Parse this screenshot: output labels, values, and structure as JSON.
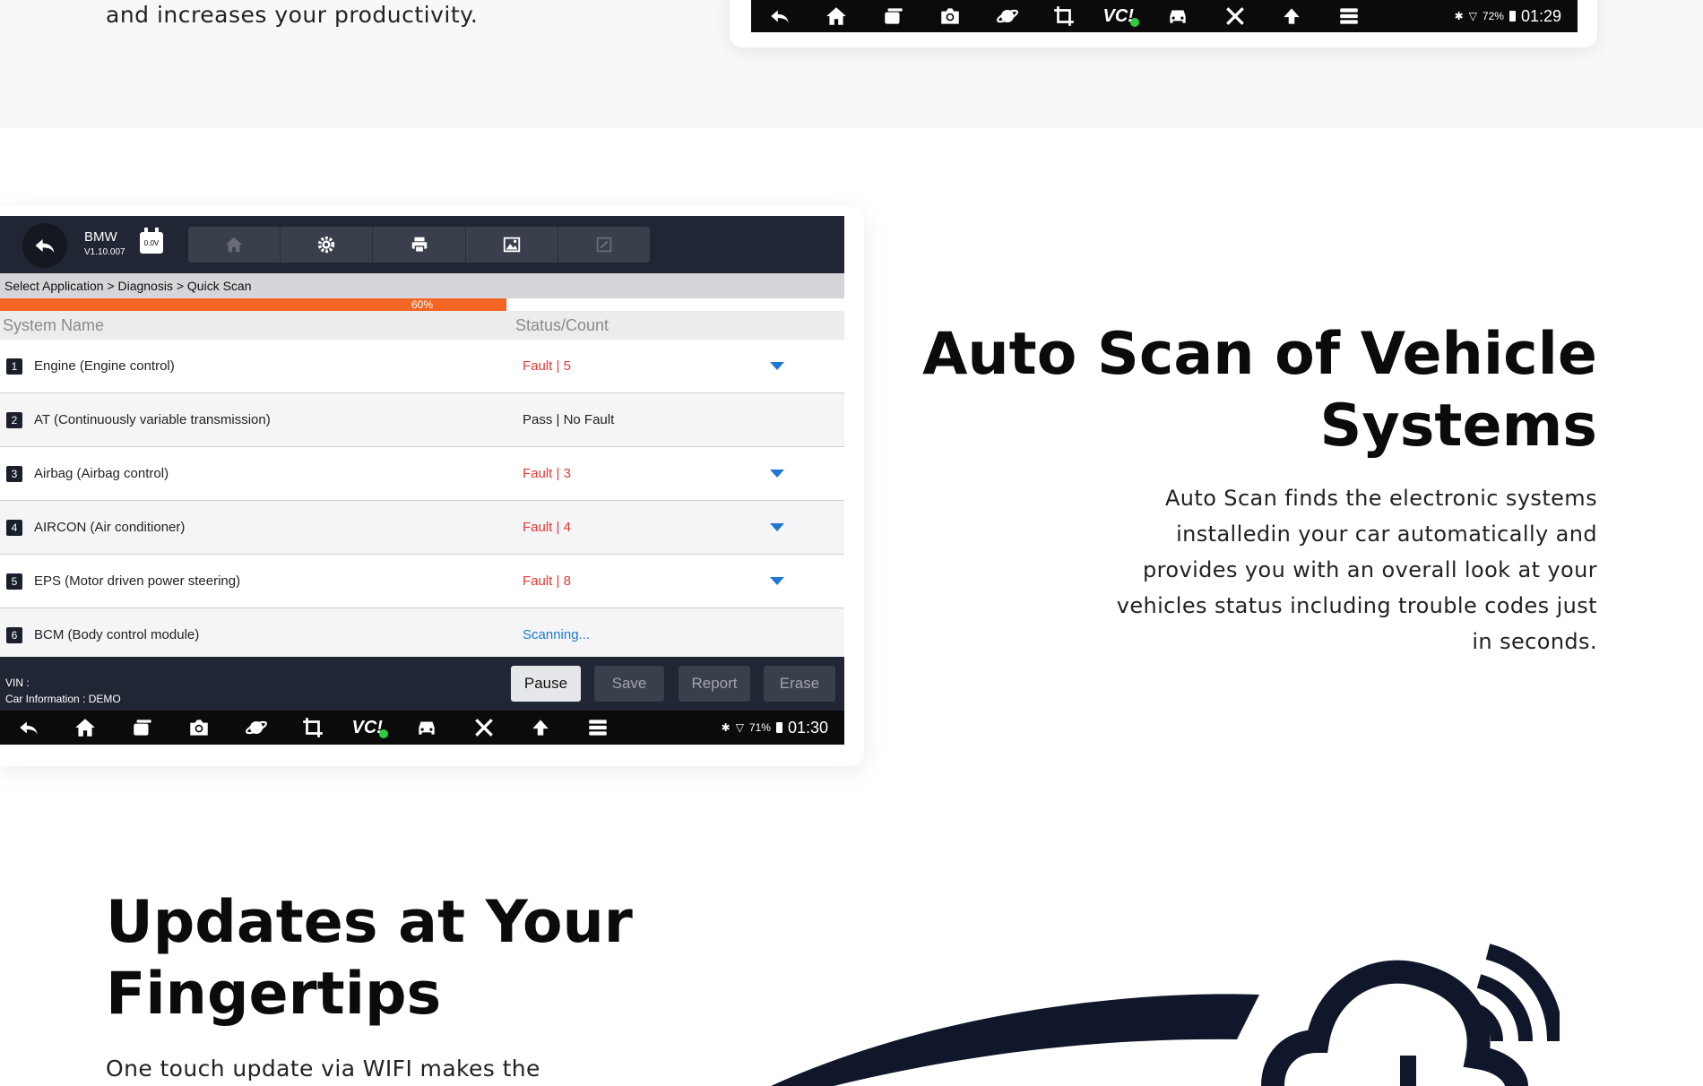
{
  "top_section": {
    "text": "and increases your productivity.",
    "statusbar": {
      "bluetooth": "✱",
      "wifi": "▽",
      "battery": "72%",
      "time": "01:29"
    }
  },
  "nav_icons": [
    "back-icon",
    "home-icon",
    "recent-apps-icon",
    "camera-icon",
    "planet-icon",
    "crop-icon",
    "vci-icon",
    "car-icon",
    "tools-icon",
    "upload-icon",
    "menu-icon"
  ],
  "vci_label": "VC!",
  "auto_scan_screen": {
    "brand": "BMW",
    "version": "V1.10.007",
    "voltage": "0.0V",
    "breadcrumb": "Select Application > Diagnosis > Quick Scan",
    "progress": {
      "value": 60,
      "label": "60%"
    },
    "columns": {
      "system_name": "System Name",
      "status": "Status/Count"
    },
    "systems": [
      {
        "num": "1",
        "name": "Engine (Engine control)",
        "status": "Fault | 5",
        "kind": "fault",
        "expand": true
      },
      {
        "num": "2",
        "name": "AT (Continuously variable transmission)",
        "status": "Pass | No Fault",
        "kind": "pass",
        "expand": false
      },
      {
        "num": "3",
        "name": "Airbag (Airbag control)",
        "status": "Fault | 3",
        "kind": "fault",
        "expand": true
      },
      {
        "num": "4",
        "name": "AIRCON (Air conditioner)",
        "status": "Fault | 4",
        "kind": "fault",
        "expand": true
      },
      {
        "num": "5",
        "name": "EPS (Motor driven power steering)",
        "status": "Fault | 8",
        "kind": "fault",
        "expand": true
      },
      {
        "num": "6",
        "name": "BCM (Body control module)",
        "status": "Scanning...",
        "kind": "scan",
        "expand": false
      }
    ],
    "vin_label": "VIN :",
    "car_info": "Car Information : DEMO",
    "buttons": {
      "pause": "Pause",
      "save": "Save",
      "report": "Report",
      "erase": "Erase"
    },
    "statusbar": {
      "bluetooth": "✱",
      "wifi": "▽",
      "battery": "71%",
      "time": "01:30"
    }
  },
  "auto_scan_section": {
    "title": "Auto Scan of Vehicle Systems",
    "description": "Auto Scan finds the electronic systems installedin your car automatically and provides you with an overall look at your vehicles status including trouble codes just in seconds."
  },
  "updates_section": {
    "title": "Updates at Your Fingertips",
    "description": "One touch update via WIFI makes the"
  },
  "colors": {
    "accent_orange": "#f26522",
    "fault_red": "#e53935",
    "link_blue": "#1f78d1",
    "header_dark": "#212634"
  }
}
